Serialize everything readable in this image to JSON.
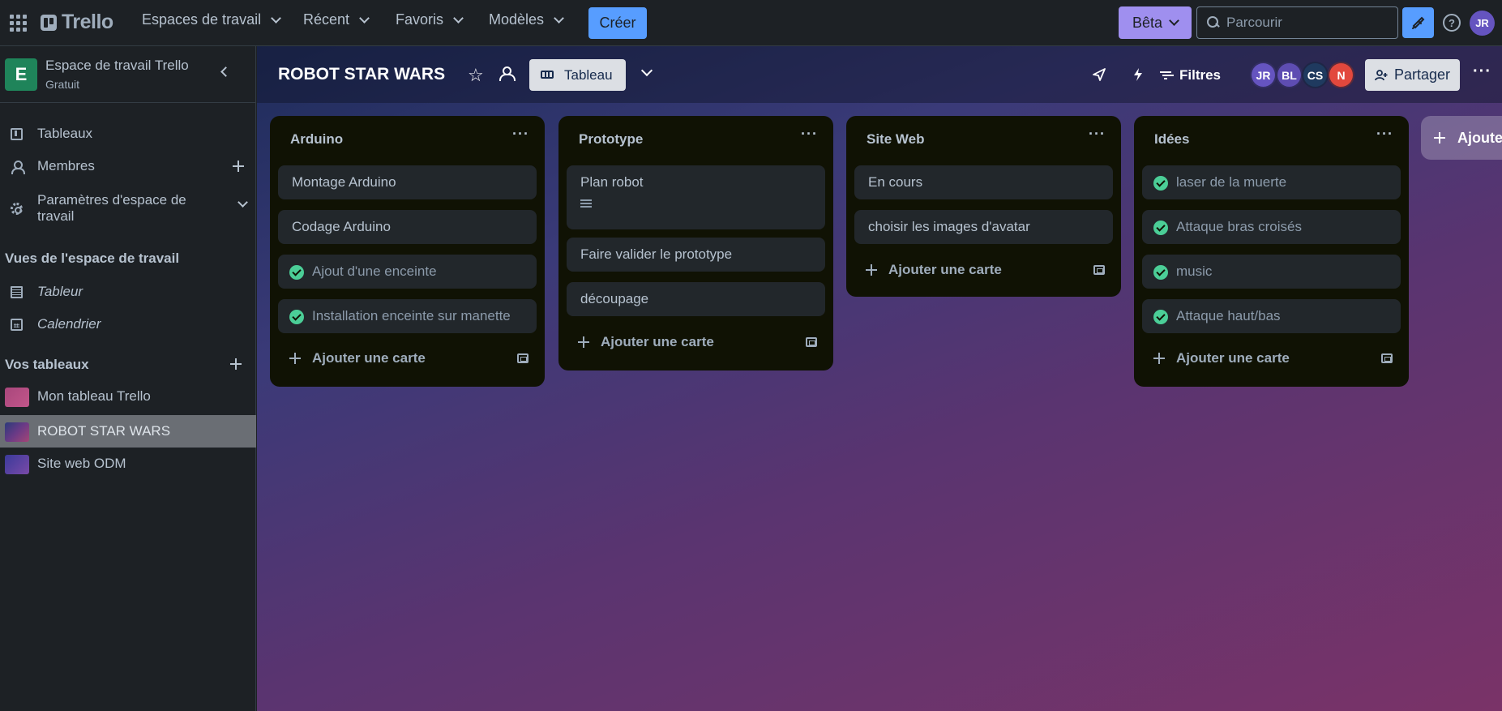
{
  "topbar": {
    "logo": "Trello",
    "menus": [
      "Espaces de travail",
      "Récent",
      "Favoris",
      "Modèles"
    ],
    "create_label": "Créer",
    "beta_label": "Bêta",
    "search_placeholder": "Parcourir",
    "user_initials": "JR"
  },
  "sidebar": {
    "workspace_letter": "E",
    "workspace_name": "Espace de travail Trello",
    "workspace_plan": "Gratuit",
    "items": [
      "Tableaux",
      "Membres",
      "Paramètres d'espace de",
      "travail"
    ],
    "views_heading": "Vues de l'espace de travail",
    "views": [
      "Tableur",
      "Calendrier"
    ],
    "boards_heading": "Vos tableaux",
    "boards": [
      {
        "name": "Mon tableau Trello",
        "color": "#b04a7e"
      },
      {
        "name": "ROBOT STAR WARS",
        "color": "#4a4a9a"
      },
      {
        "name": "Site web ODM",
        "color": "#5a3aa0"
      }
    ]
  },
  "board": {
    "title": "ROBOT STAR WARS",
    "view_label": "Tableau",
    "filter_label": "Filtres",
    "share_label": "Partager",
    "members": [
      {
        "initials": "JR",
        "color": "#6554c0"
      },
      {
        "initials": "BL",
        "color": "#5e4db2"
      },
      {
        "initials": "CS",
        "color": "#1f3a5f"
      },
      {
        "initials": "N",
        "color": "#e2483d"
      }
    ],
    "add_card_label": "Ajouter une carte",
    "add_list_label": "Ajoutez",
    "lists": [
      {
        "title": "Arduino",
        "cards": [
          {
            "text": "Montage Arduino",
            "done": false
          },
          {
            "text": "Codage Arduino",
            "done": false
          },
          {
            "text": "Ajout d'une enceinte",
            "done": true
          },
          {
            "text": "Installation enceinte sur manette",
            "done": true
          }
        ]
      },
      {
        "title": "Prototype",
        "cards": [
          {
            "text": "Plan robot",
            "done": false,
            "has_description": true
          },
          {
            "text": "Faire valider le prototype",
            "done": false
          },
          {
            "text": "découpage",
            "done": false
          }
        ]
      },
      {
        "title": "Site Web",
        "cards": [
          {
            "text": "En cours",
            "done": false
          },
          {
            "text": "choisir les images d'avatar",
            "done": false
          }
        ]
      },
      {
        "title": "Idées",
        "cards": [
          {
            "text": "laser de la muerte",
            "done": true
          },
          {
            "text": "Attaque bras croisés",
            "done": true
          },
          {
            "text": "music",
            "done": true
          },
          {
            "text": "Attaque haut/bas",
            "done": true
          }
        ]
      }
    ]
  }
}
